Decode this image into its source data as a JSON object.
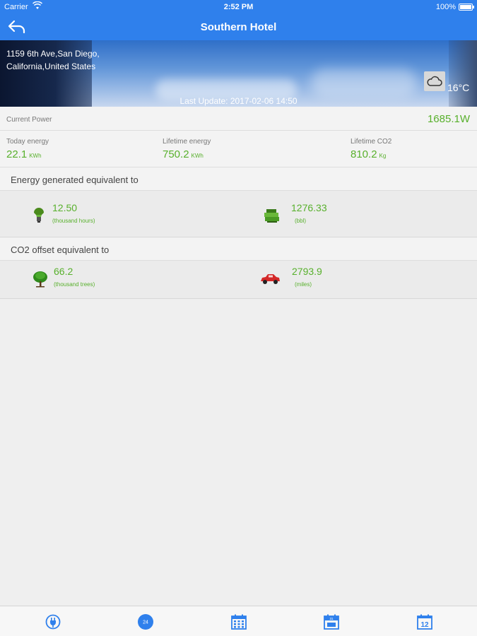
{
  "status_bar": {
    "carrier": "Carrier",
    "time": "2:52 PM",
    "battery": "100%"
  },
  "nav": {
    "title": "Southern Hotel"
  },
  "hero": {
    "address_line1": "1159 6th Ave,San Diego,",
    "address_line2": "California,United States",
    "temperature": "16°C",
    "last_update": "Last Update: 2017-02-06 14:50",
    "weather_icon": "cloud-icon"
  },
  "power": {
    "label": "Current Power",
    "value": "1685.1W"
  },
  "energy": {
    "today": {
      "label": "Today energy",
      "value": "22.1",
      "unit": "KWh"
    },
    "lifetime": {
      "label": "Lifetime energy",
      "value": "750.2",
      "unit": "KWh"
    },
    "co2": {
      "label": "Lifetime CO2",
      "value": "810.2",
      "unit": "Kg"
    }
  },
  "energy_equiv": {
    "header": "Energy generated equivalent to",
    "bulb": {
      "value": "12.50",
      "unit": "(thousand hours)",
      "icon": "light-bulb-icon"
    },
    "oil": {
      "value": "1276.33",
      "unit": "(bbl)",
      "icon": "oil-barrel-icon"
    }
  },
  "co2_equiv": {
    "header": "CO2 offset equivalent to",
    "trees": {
      "value": "66.2",
      "unit": "(thousand trees)",
      "icon": "tree-icon"
    },
    "car": {
      "value": "2793.9",
      "unit": "(miles)",
      "icon": "car-icon"
    }
  },
  "tabs": [
    {
      "icon": "plug-icon"
    },
    {
      "icon": "24h-clock-icon",
      "text": "24"
    },
    {
      "icon": "month-calendar-icon"
    },
    {
      "icon": "year-calendar-icon",
      "text": "31"
    },
    {
      "icon": "total-calendar-icon",
      "text": "12"
    }
  ],
  "colors": {
    "primary": "#2f80ec",
    "value_green": "#58b02c",
    "background": "#efefef"
  }
}
